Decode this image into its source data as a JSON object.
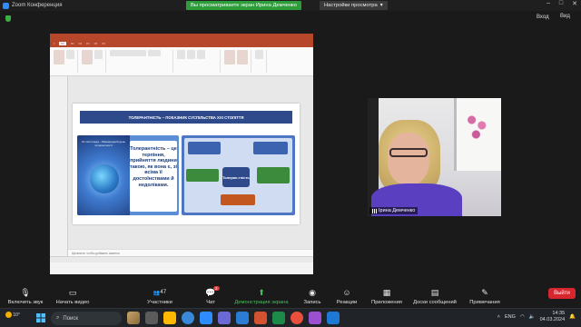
{
  "window": {
    "title": "Zoom Конференция"
  },
  "banner": {
    "share_notice": "Вы просматриваете экран Ирина Демченко",
    "view_options": "Настройки просмотра"
  },
  "top_right": {
    "enter_label": "Вход",
    "view_label": "Вид"
  },
  "slide": {
    "header": "ТОЛЕРАНТНІСТЬ – ПОКАЗНИК СУСПІЛЬСТВА XXI СТОЛІТТЯ",
    "scene_caption": "16 листопада – Міжнародний день толерантності",
    "definition": "Толерантність – це терпіння, прийняття людини такою, як вона є, зі всіма її достоїнствами й недоліками.",
    "center_node": "Толеран-тність",
    "notes_placeholder": "Щелкните, чтобы добавить заметки"
  },
  "video": {
    "participant_name": "Ірина Демченко"
  },
  "toolbar": {
    "mic": "Включить звук",
    "video": "Начать видео",
    "participants": "Участники",
    "participants_count": "47",
    "chat": "Чат",
    "chat_badge": "2",
    "share": "Демонстрация экрана",
    "record": "Запись",
    "reactions": "Реакции",
    "apps": "Приложения",
    "whiteboards": "Доски сообщений",
    "notes": "Примечания",
    "end": "Выйти"
  },
  "taskbar": {
    "weather_temp": "10°",
    "search_placeholder": "Поиск",
    "lang": "ENG",
    "time": "14:35",
    "date": "04.03.2024"
  },
  "colors": {
    "share_green": "#2d9d3a",
    "end_red": "#d7262d",
    "ppt_red": "#b7472a",
    "slide_blue": "#2e4a8a"
  }
}
